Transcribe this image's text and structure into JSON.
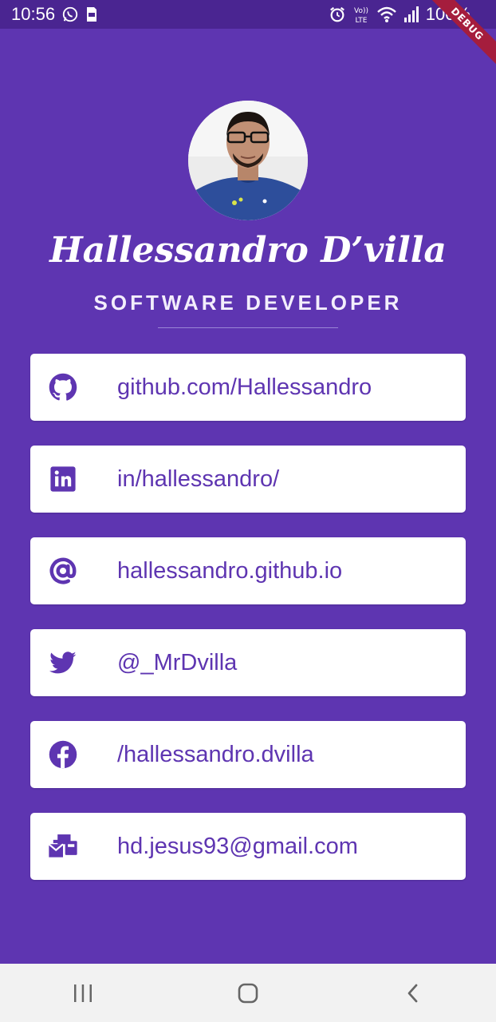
{
  "status_bar": {
    "time": "10:56",
    "battery": "100%",
    "icons": [
      "whatsapp-icon",
      "sd-card-icon",
      "alarm-icon",
      "volte-icon",
      "wifi-icon",
      "signal-icon"
    ],
    "debug_banner": "DEBUG"
  },
  "profile": {
    "name": "Hallessandro D’villa",
    "role": "SOFTWARE DEVELOPER"
  },
  "contacts": [
    {
      "icon": "github-icon",
      "label": "github.com/Hallessandro"
    },
    {
      "icon": "linkedin-icon",
      "label": "in/hallessandro/"
    },
    {
      "icon": "at-icon",
      "label": "hallessandro.github.io"
    },
    {
      "icon": "twitter-icon",
      "label": "@_MrDvilla"
    },
    {
      "icon": "facebook-icon",
      "label": "/hallessandro.dvilla"
    },
    {
      "icon": "mail-bulk-icon",
      "label": "hd.jesus93@gmail.com"
    }
  ],
  "colors": {
    "background": "#5e35b1",
    "status_bar": "#4a2591",
    "card": "#ffffff",
    "accent": "#5e35b1",
    "nav_bar": "#f2f2f2"
  },
  "nav_bar": {
    "buttons": [
      "recent-apps-icon",
      "home-icon",
      "back-icon"
    ]
  }
}
